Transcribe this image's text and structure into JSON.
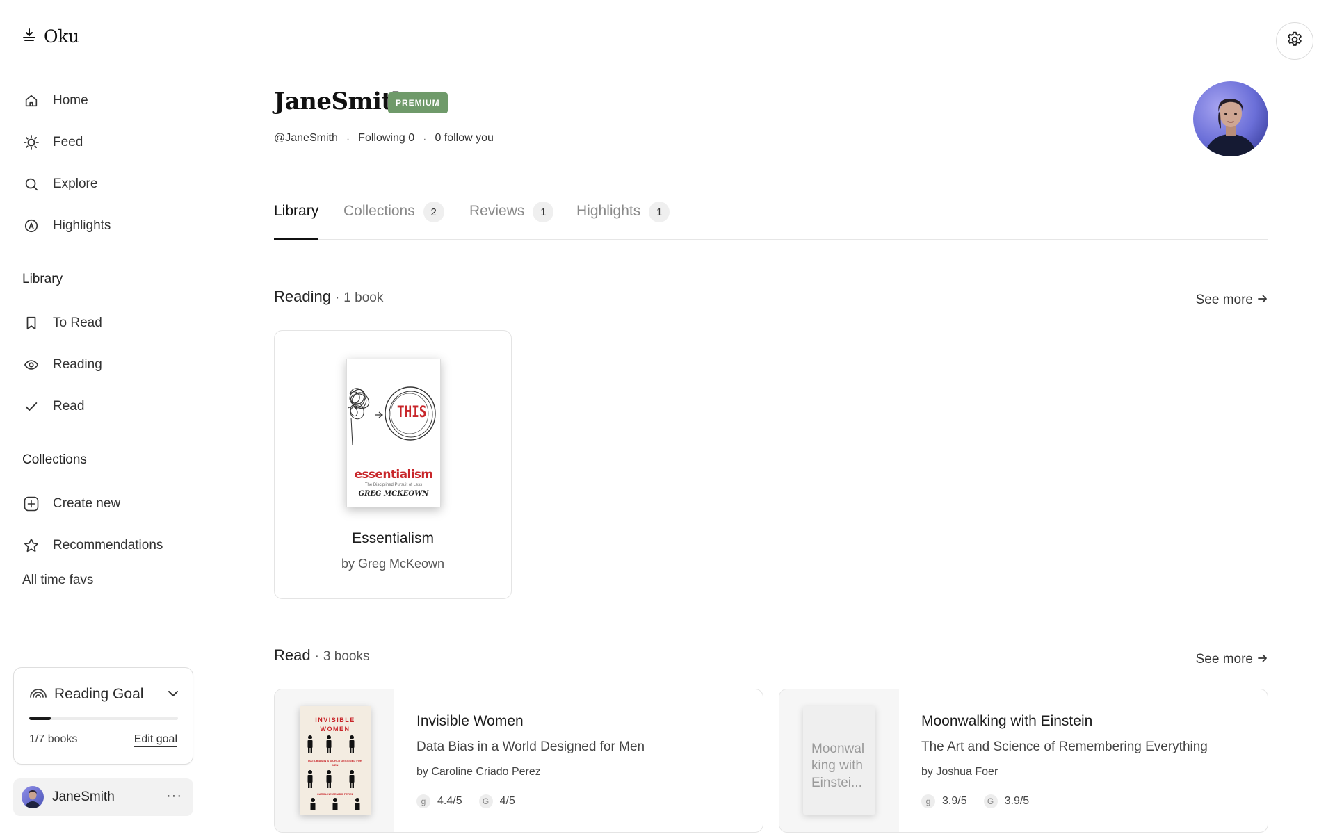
{
  "app": {
    "name": "Oku"
  },
  "sidebar": {
    "nav": [
      {
        "label": "Home"
      },
      {
        "label": "Feed"
      },
      {
        "label": "Explore"
      },
      {
        "label": "Highlights"
      }
    ],
    "library_title": "Library",
    "library": [
      {
        "label": "To Read"
      },
      {
        "label": "Reading"
      },
      {
        "label": "Read"
      }
    ],
    "collections_title": "Collections",
    "collections": [
      {
        "label": "Create new"
      },
      {
        "label": "Recommendations"
      }
    ],
    "all_time_favs": "All time favs"
  },
  "reading_goal": {
    "title": "Reading Goal",
    "progress_label": "1/7 books",
    "read": 1,
    "target": 7,
    "edit_label": "Edit goal"
  },
  "user": {
    "name": "JaneSmith",
    "more": "···"
  },
  "profile": {
    "name": "JaneSmith",
    "badge": "PREMIUM",
    "handle": "@JaneSmith",
    "following": "Following 0",
    "followers": "0 follow you",
    "separator": "·"
  },
  "tabs": [
    {
      "label": "Library",
      "count": ""
    },
    {
      "label": "Collections",
      "count": "2"
    },
    {
      "label": "Reviews",
      "count": "1"
    },
    {
      "label": "Highlights",
      "count": "1"
    }
  ],
  "reading_section": {
    "title": "Reading",
    "separator": "·",
    "count": "1 book",
    "see_more": "See more",
    "books": [
      {
        "title": "Essentialism",
        "author": "by Greg McKeown",
        "cover": {
          "word": "THIS",
          "title": "essentialism",
          "subtitle": "The Disciplined Pursuit of Less",
          "author": "GREG MCKEOWN"
        }
      }
    ]
  },
  "read_section": {
    "title": "Read",
    "separator": "·",
    "count": "3 books",
    "see_more": "See more",
    "books": [
      {
        "title": "Invisible Women",
        "subtitle": "Data Bias in a World Designed for Men",
        "author": "by Caroline Criado Perez",
        "rating_goodreads": "4.4/5",
        "rating_google": "4/5",
        "cover": {
          "title": "INVISIBLE WOMEN",
          "subtitle": "DATA BIAS IN A WORLD DESIGNED FOR MEN",
          "author": "CAROLINE CRIADO PEREZ"
        }
      },
      {
        "title": "Moonwalking with Einstein",
        "subtitle": "The Art and Science of Remembering Everything",
        "author": "by Joshua Foer",
        "rating_goodreads": "3.9/5",
        "rating_google": "3.9/5",
        "cover_placeholder": "Moonwalking with Einstei..."
      }
    ]
  },
  "rating_icons": {
    "goodreads": "g",
    "google": "G"
  },
  "colors": {
    "premium": "#6f9a6a",
    "accent": "#111111",
    "cover_red": "#c8262a"
  }
}
